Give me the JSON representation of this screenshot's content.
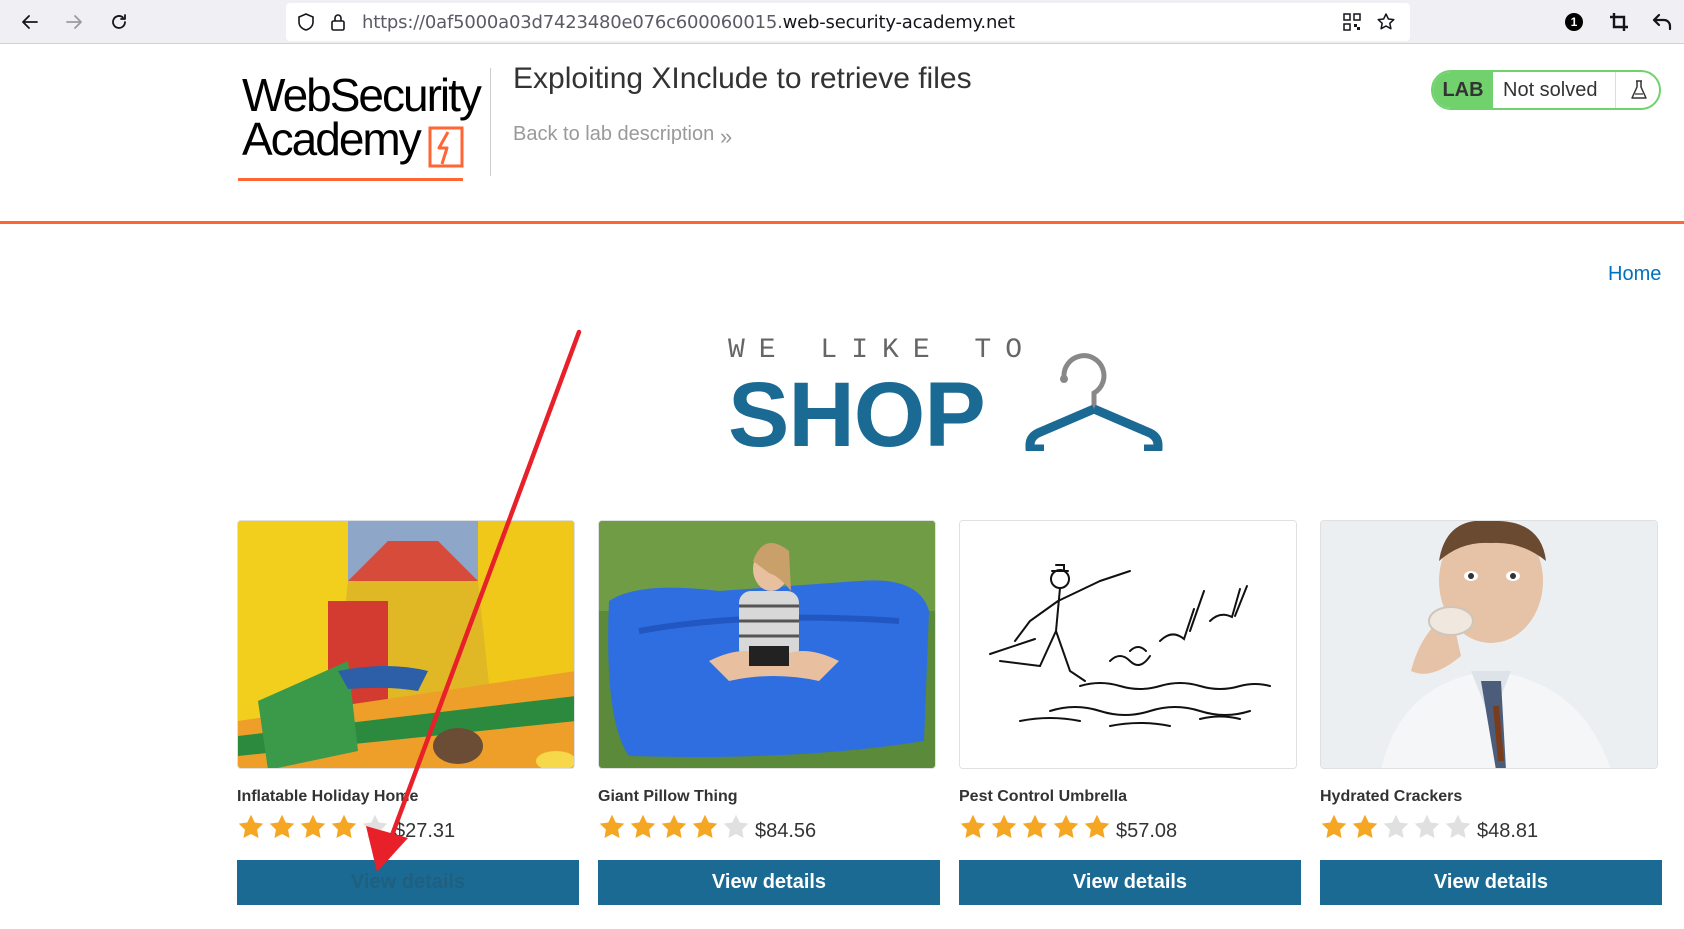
{
  "browser": {
    "url_prefix": "https://0af5000a03d7423480e076c600060015.",
    "url_host": "web-security-academy.net",
    "notification_count": "1"
  },
  "lab": {
    "logo_line1": "WebSecurity",
    "logo_line2": "Academy",
    "title": "Exploiting XInclude to retrieve files",
    "back_link": "Back to lab description",
    "status_badge": "LAB",
    "status_text": "Not solved"
  },
  "nav": {
    "home": "Home"
  },
  "banner": {
    "tagline": "WE LIKE TO",
    "shop": "SHOP"
  },
  "products": [
    {
      "name": "Inflatable Holiday Home",
      "rating": 4,
      "price": "$27.31",
      "button": "View details"
    },
    {
      "name": "Giant Pillow Thing",
      "rating": 4,
      "price": "$84.56",
      "button": "View details"
    },
    {
      "name": "Pest Control Umbrella",
      "rating": 5,
      "price": "$57.08",
      "button": "View details"
    },
    {
      "name": "Hydrated Crackers",
      "rating": 2,
      "price": "$48.81",
      "button": "View details"
    }
  ],
  "colors": {
    "accent_orange": "#ff6633",
    "brand_blue": "#1a6a94",
    "lab_green": "#70d16d",
    "link_blue": "#0071bc",
    "star_gold": "#f5a623",
    "star_empty": "#e0e0e0",
    "annotation_red": "#e8202a"
  }
}
